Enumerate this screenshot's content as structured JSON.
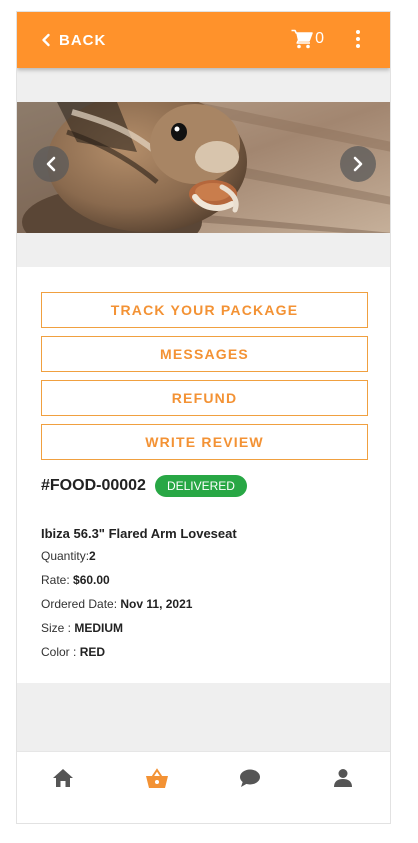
{
  "header": {
    "back_label": "BACK",
    "cart_count": "0",
    "accent_color": "#ff922b"
  },
  "banner": {
    "image": "chipmunk eating a nut",
    "prev_icon": "chevron-left-icon",
    "next_icon": "chevron-right-icon"
  },
  "actions": {
    "track": "TRACK YOUR PACKAGE",
    "messages": "MESSAGES",
    "refund": "REFUND",
    "review": "WRITE REVIEW"
  },
  "order": {
    "id": "#FOOD-00002",
    "status": "DELIVERED",
    "status_color": "#28a745",
    "product": "Ibiza 56.3\" Flared Arm Loveseat",
    "quantity_label": "Quantity:",
    "quantity": "2",
    "rate_label": "Rate: ",
    "rate": "$60.00",
    "date_label": "Ordered Date: ",
    "date": "Nov 11, 2021",
    "size_label": "Size : ",
    "size": "MEDIUM",
    "color_label": "Color : ",
    "color": "RED"
  },
  "bottom_nav": {
    "items": [
      {
        "icon": "home-icon",
        "active": false
      },
      {
        "icon": "basket-icon",
        "active": true
      },
      {
        "icon": "chat-icon",
        "active": false
      },
      {
        "icon": "user-icon",
        "active": false
      }
    ],
    "active_color": "#f39234",
    "inactive_color": "#555555"
  }
}
